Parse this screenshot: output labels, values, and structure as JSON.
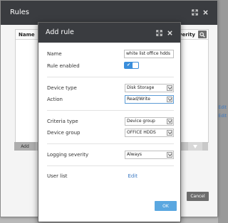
{
  "rules_window": {
    "title": "Rules",
    "columns": {
      "name": "Name",
      "severity": "Severity"
    },
    "add_label": "Add",
    "cancel_label": "Cancel",
    "edit_link": "Edit"
  },
  "add_rule": {
    "title": "Add rule",
    "fields": {
      "name": {
        "label": "Name",
        "value": "white list office hdds"
      },
      "rule_enabled": {
        "label": "Rule enabled",
        "checked": true
      },
      "device_type": {
        "label": "Device type",
        "value": "Disk Storage"
      },
      "action": {
        "label": "Action",
        "value": "Read/Write"
      },
      "criteria_type": {
        "label": "Criteria type",
        "value": "Device group"
      },
      "device_group": {
        "label": "Device group",
        "value": "OFFICE HDDS"
      },
      "logging_severity": {
        "label": "Logging severity",
        "value": "Always"
      },
      "user_list": {
        "label": "User list",
        "link": "Edit"
      }
    },
    "ok_label": "OK"
  },
  "icons": {
    "maximize": "expand-icon",
    "close": "close-icon",
    "search": "search-icon",
    "dropdown": "chevron-down-icon",
    "check": "checkmark-icon"
  },
  "colors": {
    "titlebar": "#3a3c40",
    "accent": "#3a8edb",
    "ok_button": "#5aa7e0",
    "link": "#3a78c2"
  }
}
